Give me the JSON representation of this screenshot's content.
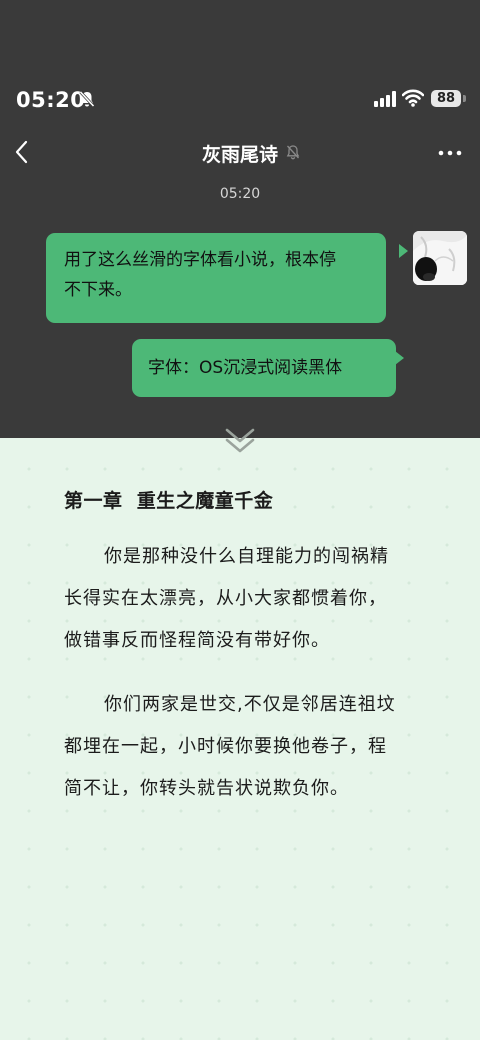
{
  "status_bar": {
    "time": "05:20",
    "battery": "88"
  },
  "chat": {
    "title": "灰雨尾诗",
    "message_time": "05:20",
    "messages": [
      {
        "lines": [
          "用了这么丝滑的字体看小说，根本停",
          "不下来。"
        ]
      },
      {
        "lines": [
          "字体：OS沉浸式阅读黑体"
        ]
      }
    ]
  },
  "reader": {
    "chapter_title": "第一章  重生之魔童千金",
    "paragraphs": [
      {
        "lines": [
          "你是那种没什么自理能力的闯祸精",
          "长得实在太漂亮，从小大家都惯着你，",
          "做错事反而怪程简没有带好你。"
        ]
      },
      {
        "lines": [
          "你们两家是世交,不仅是邻居连祖坟",
          "都埋在一起，小时候你要换他卷子，程",
          "简不让，你转头就告状说欺负你。"
        ]
      }
    ]
  },
  "colors": {
    "chat_bg": "#3a3a3a",
    "bubble": "#4db877",
    "reader_bg": "#e7f5ea"
  },
  "icons": [
    "mute-icon",
    "signal-icon",
    "wifi-icon",
    "battery-icon",
    "back-icon",
    "bell-off-icon",
    "more-icon",
    "chevron-down-icon"
  ]
}
